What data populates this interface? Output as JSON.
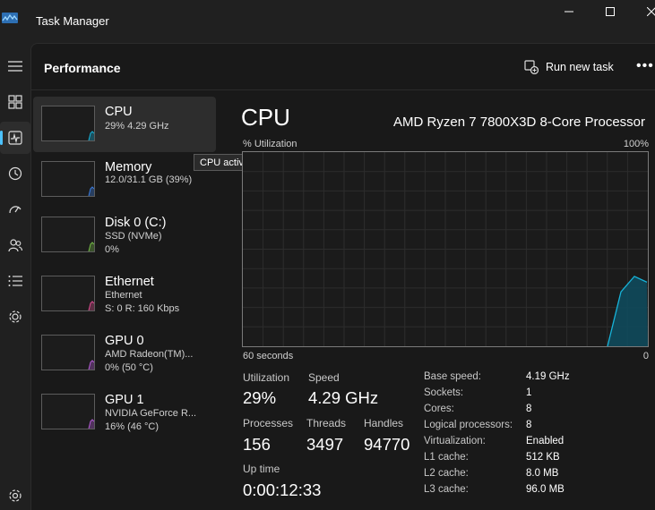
{
  "window": {
    "title": "Task Manager"
  },
  "header": {
    "title": "Performance",
    "run_new_task": "Run new task"
  },
  "sidebar_items": [
    {
      "title": "CPU",
      "line1": "29%  4.29 GHz",
      "line2": "",
      "color": "#17b3d9",
      "selected": true
    },
    {
      "title": "Memory",
      "line1": "12.0/31.1 GB (39%)",
      "line2": "",
      "color": "#3b7de0",
      "selected": false
    },
    {
      "title": "Disk 0 (C:)",
      "line1": "SSD (NVMe)",
      "line2": "0%",
      "color": "#74b946",
      "selected": false
    },
    {
      "title": "Ethernet",
      "line1": "Ethernet",
      "line2": "S: 0 R: 160 Kbps",
      "color": "#d94c8f",
      "selected": false
    },
    {
      "title": "GPU 0",
      "line1": "AMD Radeon(TM)...",
      "line2": "0% (50 °C)",
      "color": "#b45cd6",
      "selected": false
    },
    {
      "title": "GPU 1",
      "line1": "NVIDIA GeForce R...",
      "line2": "16% (46 °C)",
      "color": "#b45cd6",
      "selected": false
    }
  ],
  "tooltip": "CPU activity",
  "detail": {
    "title": "CPU",
    "processor": "AMD Ryzen 7 7800X3D 8-Core Processor",
    "utilization_label": "% Utilization",
    "max_label": "100%",
    "time_label": "60 seconds",
    "zero_label": "0"
  },
  "stats": {
    "utilization": {
      "label": "Utilization",
      "value": "29%"
    },
    "speed": {
      "label": "Speed",
      "value": "4.29 GHz"
    },
    "processes": {
      "label": "Processes",
      "value": "156"
    },
    "threads": {
      "label": "Threads",
      "value": "3497"
    },
    "handles": {
      "label": "Handles",
      "value": "94770"
    },
    "uptime": {
      "label": "Up time",
      "value": "0:00:12:33"
    }
  },
  "specs": [
    {
      "label": "Base speed:",
      "value": "4.19 GHz"
    },
    {
      "label": "Sockets:",
      "value": "1"
    },
    {
      "label": "Cores:",
      "value": "8"
    },
    {
      "label": "Logical processors:",
      "value": "8"
    },
    {
      "label": "Virtualization:",
      "value": "Enabled"
    },
    {
      "label": "L1 cache:",
      "value": "512 KB"
    },
    {
      "label": "L2 cache:",
      "value": "8.0 MB"
    },
    {
      "label": "L3 cache:",
      "value": "96.0 MB"
    }
  ],
  "cpu_history": [
    0,
    0,
    0,
    0,
    0,
    0,
    0,
    0,
    0,
    0,
    0,
    0,
    0,
    0,
    0,
    0,
    0,
    0,
    0,
    0,
    0,
    0,
    0,
    0,
    0,
    0,
    0,
    0,
    0,
    0,
    0,
    0,
    0,
    0,
    0,
    0,
    0,
    0,
    0,
    0,
    0,
    0,
    0,
    0,
    0,
    0,
    0,
    0,
    0,
    0,
    0,
    0,
    0,
    0,
    0,
    0,
    0,
    0,
    28,
    36,
    33
  ],
  "colors": {
    "accent": "#4cc2ff",
    "cpu_line": "#17b3d9",
    "cpu_fill": "#0f4a5c",
    "grid": "#2d2d2d"
  }
}
